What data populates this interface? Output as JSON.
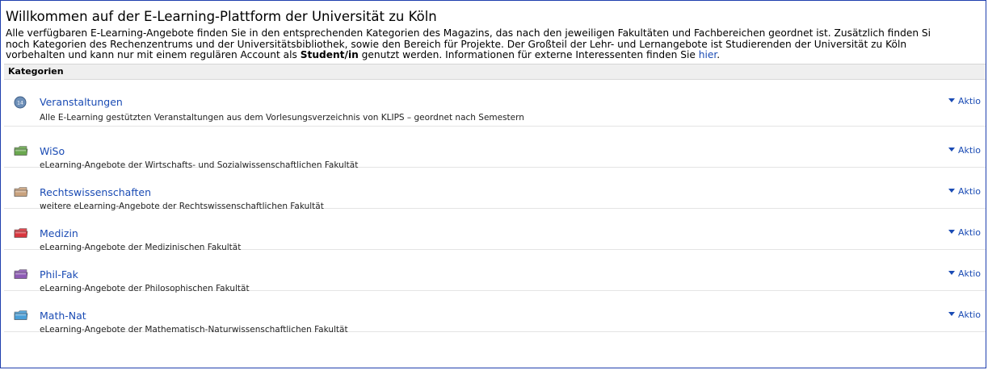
{
  "page": {
    "title": "Willkommen auf der E-Learning-Plattform der Universität zu Köln",
    "intro_line1": "Alle verfügbaren E-Learning-Angebote finden Sie in den entsprechenden Kategorien des Magazins, das nach den jeweiligen Fakultäten und Fachbereichen geordnet ist. Zusätzlich finden Si",
    "intro_line2": "noch Kategorien des Rechenzentrums und der Universitätsbibliothek, sowie den Bereich für Projekte. Der Großteil der Lehr- und Lernangebote ist Studierenden der Universität zu Köln",
    "intro_line3_a": "vorbehalten und kann nur mit einem regulären Account als ",
    "intro_line3_bold": "Student/in",
    "intro_line3_b": " genutzt werden. Informationen für externe Interessenten finden Sie ",
    "intro_link": "hier",
    "intro_line3_end": "."
  },
  "categories": {
    "header": "Kategorien",
    "action_label": "Aktio",
    "items": [
      {
        "name": "Veranstaltungen",
        "desc": "Alle E-Learning gestützten Veranstaltungen aus dem Vorlesungsverzeichnis von KLIPS – geordnet nach Semestern",
        "icon": "globe-icon",
        "color": "#6d8fb8"
      },
      {
        "name": "WiSo",
        "desc": "eLearning-Angebote der Wirtschafts- und Sozialwissenschaftlichen Fakultät",
        "icon": "folder-green-icon",
        "color": "#6aa84f"
      },
      {
        "name": "Rechtswissenschaften",
        "desc": "weitere eLearning-Angebote der Rechtswissenschaftlichen Fakultät",
        "icon": "folder-tan-icon",
        "color": "#c9a27e"
      },
      {
        "name": "Medizin",
        "desc": "eLearning-Angebote der Medizinischen Fakultät",
        "icon": "folder-red-icon",
        "color": "#d9363e"
      },
      {
        "name": "Phil-Fak",
        "desc": "eLearning-Angebote der Philosophischen Fakultät",
        "icon": "folder-purple-icon",
        "color": "#8e5bb5"
      },
      {
        "name": "Math-Nat",
        "desc": "eLearning-Angebote der Mathematisch-Naturwissenschaftlichen Fakultät",
        "icon": "folder-blue-icon",
        "color": "#4a9fd8"
      }
    ]
  }
}
